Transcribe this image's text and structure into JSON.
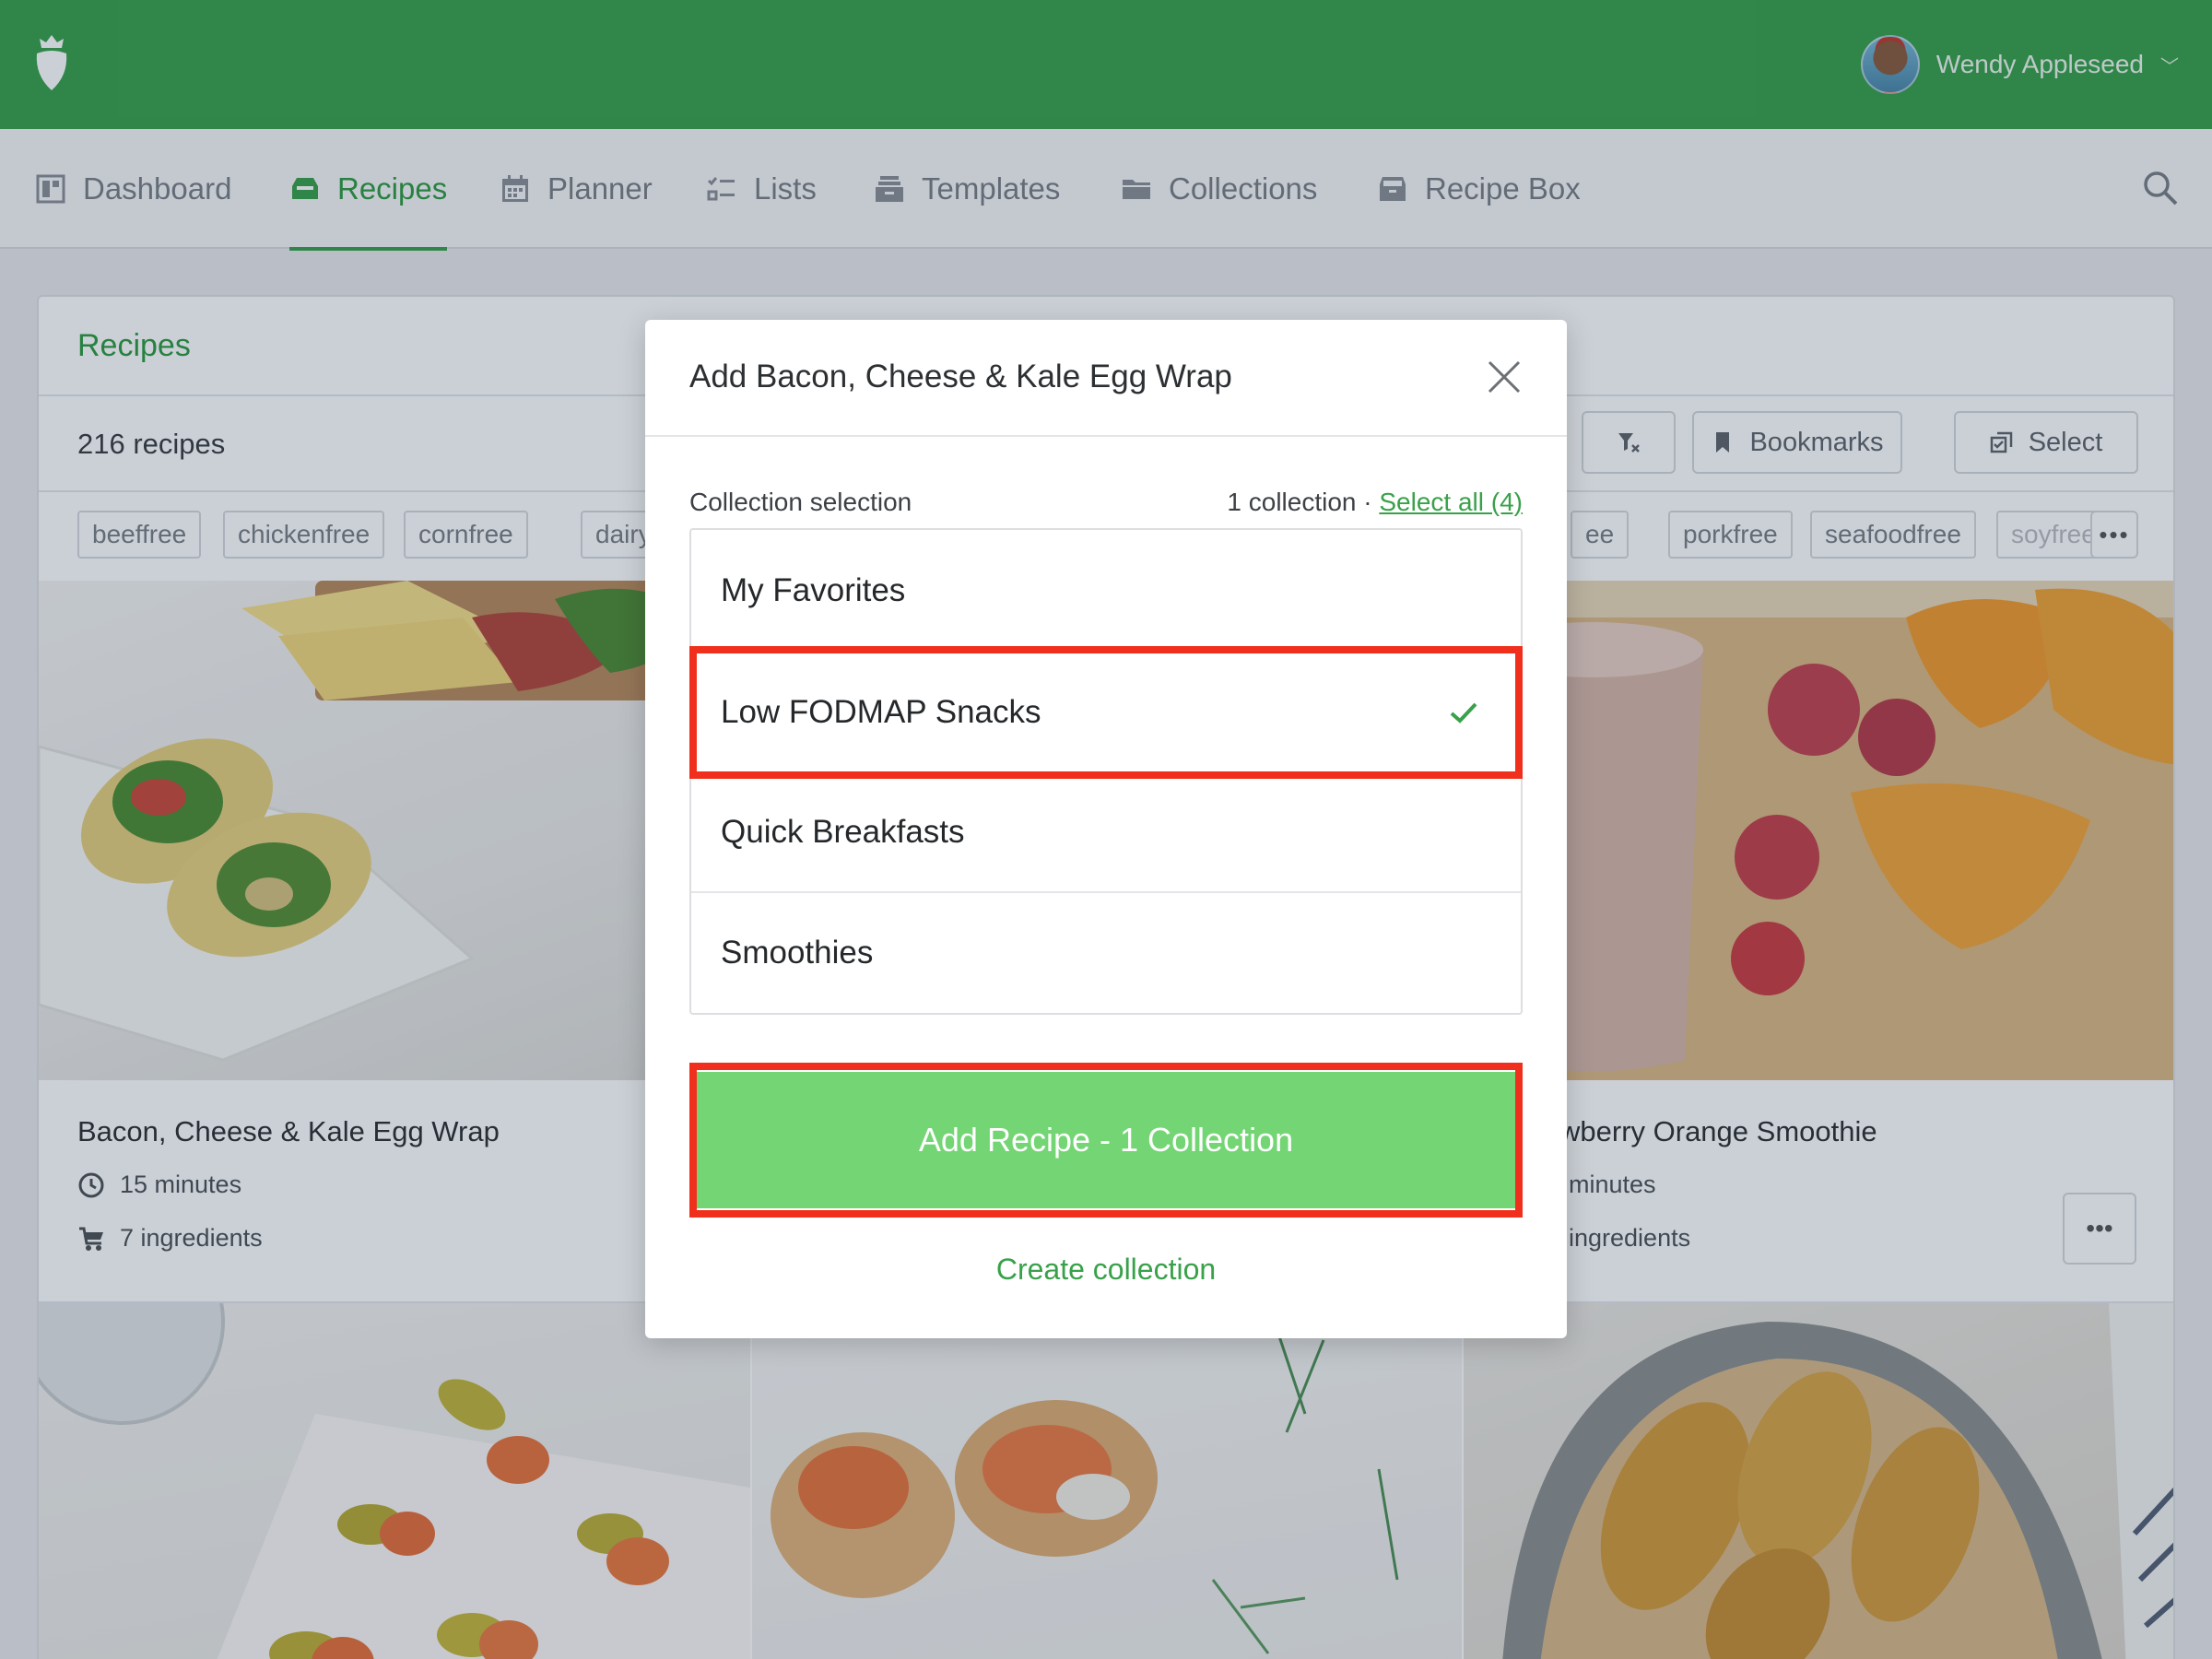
{
  "user": {
    "name": "Wendy Appleseed"
  },
  "nav": [
    {
      "label": "Dashboard",
      "icon": "dashboard-icon"
    },
    {
      "label": "Recipes",
      "icon": "recipes-icon",
      "active": true
    },
    {
      "label": "Planner",
      "icon": "calendar-icon"
    },
    {
      "label": "Lists",
      "icon": "list-icon"
    },
    {
      "label": "Templates",
      "icon": "templates-icon"
    },
    {
      "label": "Collections",
      "icon": "folder-icon"
    },
    {
      "label": "Recipe Box",
      "icon": "box-icon"
    }
  ],
  "recipes_page": {
    "title": "Recipes",
    "count": "216 recipes",
    "buttons": {
      "bookmarks": "Bookmarks",
      "select": "Select"
    },
    "tags": [
      "beeffree",
      "chickenfree",
      "cornfree",
      "dairyfree",
      "ee",
      "porkfree",
      "seafoodfree",
      "soyfree"
    ],
    "more": "•••",
    "cards": [
      {
        "title": "Bacon, Cheese & Kale Egg Wrap",
        "time": "15 minutes",
        "ingredients": "7 ingredients"
      },
      {
        "title": "wberry Orange Smoothie",
        "time": "minutes",
        "ingredients": "ingredients"
      }
    ]
  },
  "modal": {
    "title": "Add Bacon, Cheese & Kale Egg Wrap",
    "selection_label": "Collection selection",
    "selection_count": "1 collection",
    "separator": " · ",
    "select_all": "Select all (4)",
    "collections": [
      {
        "name": "My Favorites",
        "selected": false
      },
      {
        "name": "Low FODMAP Snacks",
        "selected": true
      },
      {
        "name": "Quick Breakfasts",
        "selected": false
      },
      {
        "name": "Smoothies",
        "selected": false
      }
    ],
    "add_button": "Add Recipe - 1 Collection",
    "create_link": "Create collection"
  },
  "colors": {
    "brand_green": "#39a14a",
    "button_green": "#74d574",
    "highlight_red": "#f0301d"
  }
}
